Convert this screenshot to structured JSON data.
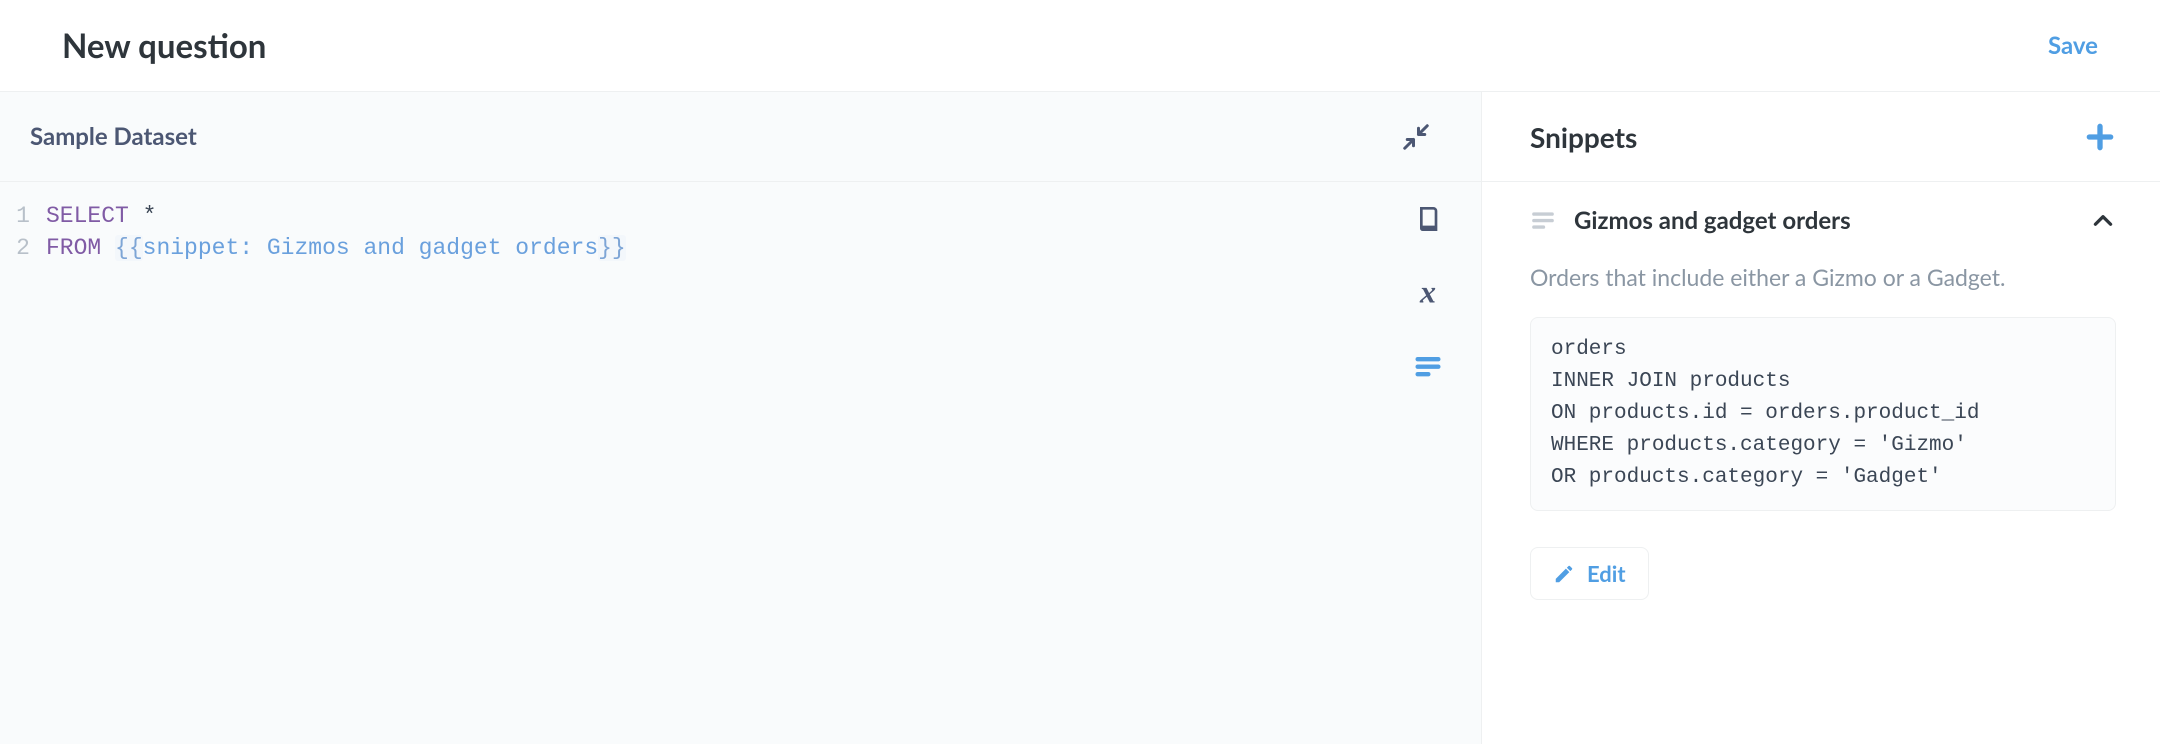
{
  "header": {
    "title": "New question",
    "save_label": "Save"
  },
  "editor": {
    "dataset_name": "Sample Dataset",
    "gutter": [
      "1",
      "2"
    ],
    "line1": {
      "kw": "SELECT",
      "rest": " *"
    },
    "line2": {
      "kw": "FROM",
      "space": " ",
      "open": "{{",
      "snippet": "snippet: Gizmos and gadget orders",
      "close": "}}"
    }
  },
  "snippets": {
    "panel_title": "Snippets",
    "item": {
      "name": "Gizmos and gadget orders",
      "description": "Orders that include either a Gizmo or a Gadget.",
      "code": "orders\nINNER JOIN products\nON products.id = orders.product_id\nWHERE products.category = 'Gizmo'\nOR products.category = 'Gadget'",
      "edit_label": "Edit"
    }
  }
}
